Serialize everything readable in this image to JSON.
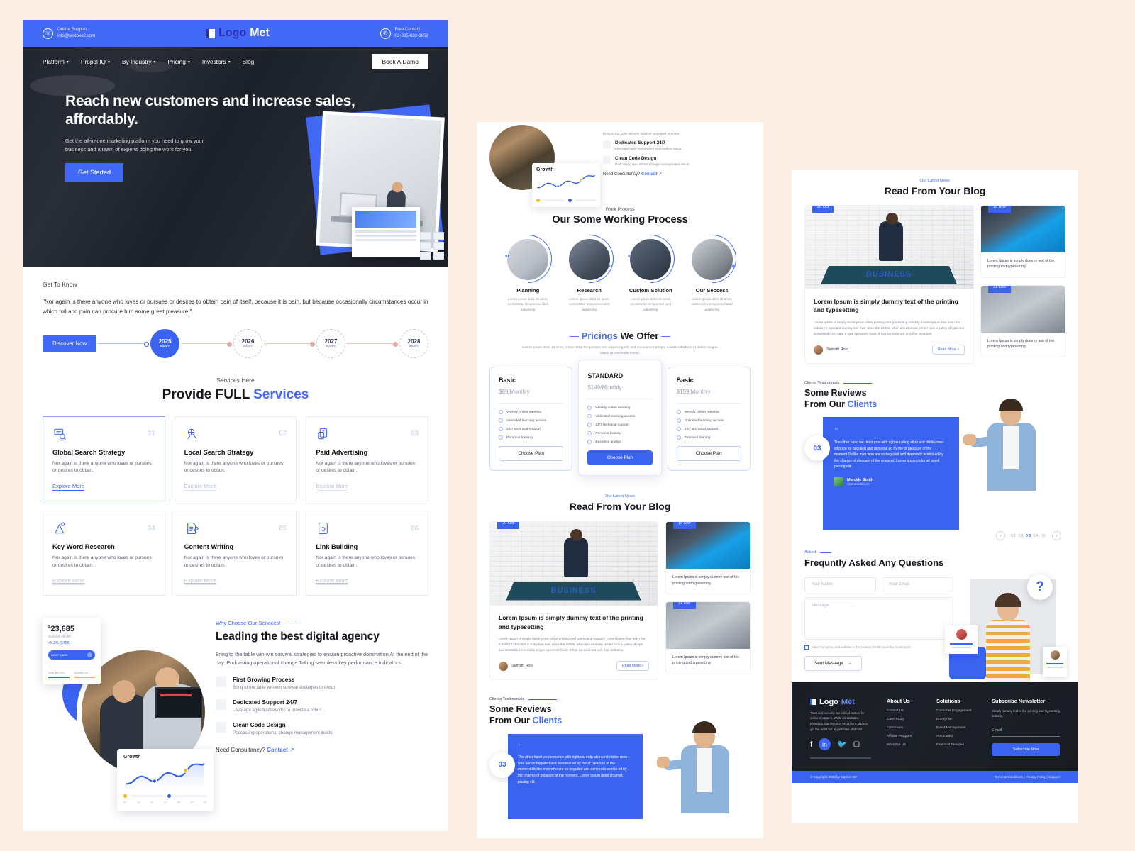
{
  "brand": {
    "name_a": "Logo",
    "name_b": "Met"
  },
  "topbar": {
    "support_label": "Online Support",
    "support_value": "info@Motoxo2.com",
    "contact_label": "Free Contact",
    "contact_value": "02-325-682-3652"
  },
  "nav": {
    "items": [
      "Platform",
      "Propel IQ",
      "By Industry",
      "Pricing",
      "Investors",
      "Blog"
    ],
    "cta": "Book A Damo"
  },
  "hero": {
    "title": "Reach new customers and increase sales, affordably.",
    "subtitle": "Get the all-in-one marketing platform you need to grow your business and a team of experts doing the work for you.",
    "cta": "Get Started"
  },
  "about": {
    "kicker": "Get To Know",
    "quote": "\"Nor again is there anyone who loves or pursues or desires to obtain pain of itself, because it is pain, but because occasionally circumstances occur in which toil and pain can procure him some great pleasure.\"",
    "cta": "Discover Now",
    "timeline": [
      {
        "year": "2025",
        "label": "Award",
        "active": true
      },
      {
        "year": "2026",
        "label": "Award",
        "active": false
      },
      {
        "year": "2027",
        "label": "Award",
        "active": false
      },
      {
        "year": "2028",
        "label": "Award",
        "active": false
      }
    ]
  },
  "services": {
    "kicker": "Services Here",
    "title_a": "Provide FULL ",
    "title_b": "Services",
    "cards": [
      {
        "num": "01",
        "title": "Global Search Strategy",
        "desc": "Nor again is there anyone who loves or pursues or desires to obtain.",
        "link": "Explore More",
        "icon": "search-globe-icon"
      },
      {
        "num": "02",
        "title": "Local Search Strategy",
        "desc": "Nor again is there anyone who loves or pursues or desires to obtain.",
        "link": "Explore More",
        "icon": "local-pin-icon"
      },
      {
        "num": "03",
        "title": "Paid Advertising",
        "desc": "Nor again is there anyone who loves or pursues or desires to obtain.",
        "link": "Explore More",
        "icon": "money-icon"
      },
      {
        "num": "04",
        "title": "Key Word Research",
        "desc": "Nor again is there anyone who loves or pursues or desires to obtain.",
        "link": "Explore More",
        "icon": "keyword-icon"
      },
      {
        "num": "05",
        "title": "Content Writing",
        "desc": "Nor again is there anyone who loves or pursues or desires to obtain.",
        "link": "Explore More",
        "icon": "pencil-doc-icon"
      },
      {
        "num": "06",
        "title": "Link Building",
        "desc": "Nor again is there anyone who loves or pursues or desires to obtain.",
        "link": "Explore More",
        "icon": "link-icon"
      }
    ]
  },
  "stats_card": {
    "currency": "$",
    "amount": "23,685",
    "deposits": "Deposits  $6,000",
    "gain": "+5.2% ($456)",
    "button": "ADD FUNDS",
    "goal_label": "Goal  $64,000",
    "duration_label": "Duration  4y"
  },
  "growth_widget": {
    "title": "Growth",
    "ticks": [
      "07",
      "13",
      "03",
      "47",
      "09",
      "27",
      "57"
    ]
  },
  "why": {
    "kicker": "Why Choose Our Services!",
    "title": "Leading the best digital agency",
    "desc": "Bring to the table win-win survival strategies to ensure proactive domination At the end of the day. Podcasting operational change Taking seamless key performance indicators...",
    "features": [
      {
        "title": "First Growing Process",
        "desc": "Bring to the table win-win survival strategies to ensur.",
        "icon": "gear-icon"
      },
      {
        "title": "Dedicated Support 24/7",
        "desc": "Leverage agile frameworks to provide a robus..",
        "icon": "headset-icon"
      },
      {
        "title": "Clean Code Design",
        "desc": "Podcasting operational change management inside.",
        "icon": "code-icon"
      }
    ],
    "consult_label": "Need Consultancy?",
    "consult_link": "Contact"
  },
  "work_process": {
    "kicker": "Work Process",
    "title": "Our Some Working Process",
    "steps": [
      {
        "num": "01",
        "title": "Planning",
        "desc": "Lorem ipsum dolor sit amet, consectetur tempoesed uted adipiscing"
      },
      {
        "num": "02",
        "title": "Research",
        "desc": "Lorem ipsum dolor sit amet, consectetur tempoesed uted adipiscing"
      },
      {
        "num": "03",
        "title": "Custom Solution",
        "desc": "Lorem ipsum dolor sit amet, consectetur tempoesed uted adipiscing"
      },
      {
        "num": "04",
        "title": "Our Seccess",
        "desc": "Lorem ipsum dolor sit amet, consectetur tempoesed uted adipiscing"
      }
    ]
  },
  "pricing": {
    "title_a": "Pricings",
    "title_b": "We Offer",
    "subtitle": "Lorem ipsum dolor sit amet, consectetur tempoesed sed adipiscing elit, sed do eiusmod tempor incidid. Ut labore et dolore magna aliqua ut commodo consu.",
    "plans": [
      {
        "name": "Basic",
        "price": "$89",
        "period": "/Monthly",
        "features": [
          "Weekly online meeting",
          "Unlimited learning access",
          "24/7 technical support",
          "Personal training"
        ],
        "button": "Choose Plan",
        "featured": false
      },
      {
        "name": "STANDARD",
        "price": "$149",
        "period": "/Monthly",
        "features": [
          "Weekly online meeting",
          "Unlimited learning access",
          "24/7 technical support",
          "Personal training",
          "Business analyst"
        ],
        "button": "Choose Plan",
        "featured": true
      },
      {
        "name": "Basic",
        "price": "$159",
        "period": "/Monthly",
        "features": [
          "Weekly online meeting",
          "Unlimited learning access",
          "24/7 technical support",
          "Personal training"
        ],
        "button": "Choose Plan",
        "featured": false
      }
    ]
  },
  "blog": {
    "kicker": "Our Latest News",
    "title": "Read From Your Blog",
    "main": {
      "date": "20 Oct",
      "banner_text": "BUSINESS",
      "title": "Lorem Ipsum is simply dummy text of the printing and typesetting",
      "excerpt": "Lorem Ipsum is simply dummy text of the printing and typesetting industry. Lorem Ipsum has been the industry's standard dummy text ever since the 1500s, when an unknown printer took a galley of type and scrambled it to make a type specimen book. It has survived not only five centuries.",
      "author": "Samsth Rota",
      "read_more": "Read More »"
    },
    "side": [
      {
        "date": "15 Nov",
        "title": "Lorem Ipsum is simply dummy text of the printing and typesetting"
      },
      {
        "date": "31 Dec",
        "title": "Lorem Ipsum is simply dummy text of the printing and typesetting"
      }
    ]
  },
  "testimonials": {
    "kicker": "Clients Testimonials",
    "title_a": "Some Reviews",
    "title_b1": "From Our ",
    "title_b2": "Clients",
    "badge": "03",
    "quote_mark": "”",
    "quote": "The other hand we denounce with righteou indg ation and dislike men who are so beguiled and demorali ed by the of pleasure of the moment.Dislike men who are so beguiled and demoraliz worlds ed by the charms of pleasure of the moment. Lorem ipsum dolor sit amet, piscing elit.",
    "author": "Maickle Smith",
    "role": "SEO and director",
    "pagination": [
      "01",
      "02",
      "03",
      "04",
      "05"
    ],
    "active_page": "03"
  },
  "faq": {
    "kicker": "Asked",
    "title": "Frequntly Asked Any Questions",
    "name_placeholder": "Your Name",
    "email_placeholder": "Your Email",
    "message_placeholder": "Message.....................",
    "checkbox_label": "Save my name, and website in the browser for the next time I comment",
    "submit": "Sent Message",
    "question_mark": "?"
  },
  "footer": {
    "desc": "Trust and security are critical factors for online shoppers. Work with solution providers that invest in securing a place to get the most out of your time and cost.",
    "socials": [
      "facebook-icon",
      "linkedin-icon",
      "twitter-icon",
      "instagram-icon"
    ],
    "columns": [
      {
        "title": "About Us",
        "links": [
          "Contact Us",
          "Case Study",
          "Customers",
          "Affiliate Program",
          "Write For Us"
        ]
      },
      {
        "title": "Solutions",
        "links": [
          "Customer Engagement",
          "Enterprise",
          "Event Management",
          "Automation",
          "Financial Services"
        ]
      }
    ],
    "newsletter": {
      "title": "Subscribe Newsletter",
      "desc": "Simply dummy text of the printing and typesetting industry.",
      "placeholder": "E-mail",
      "button": "Subscribe Now"
    },
    "copyright": "© Copyright 2023 by Ogenix WP",
    "legal": "Terms & Conditions | Privacy Policy | Support"
  },
  "colors": {
    "accent": "#4169f5",
    "dark": "#14171e",
    "page_bg": "#fdeee4"
  }
}
